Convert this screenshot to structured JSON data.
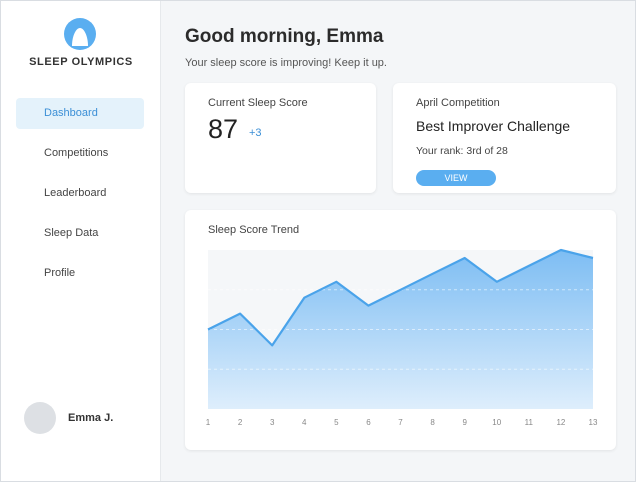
{
  "brand": {
    "name": "SLEEP OLYMPICS"
  },
  "sidebar": {
    "items": [
      {
        "label": "Dashboard",
        "active": true
      },
      {
        "label": "Competitions",
        "active": false
      },
      {
        "label": "Leaderboard",
        "active": false
      },
      {
        "label": "Sleep Data",
        "active": false
      },
      {
        "label": "Profile",
        "active": false
      }
    ],
    "user": {
      "name": "Emma J."
    }
  },
  "header": {
    "greeting": "Good morning, Emma",
    "subtitle": "Your sleep score is improving! Keep it up."
  },
  "score_card": {
    "label": "Current Sleep Score",
    "value": "87",
    "delta": "+3"
  },
  "competition_card": {
    "label": "April Competition",
    "title": "Best Improver Challenge",
    "rank": "Your rank: 3rd of 28",
    "button_label": "VIEW"
  },
  "colors": {
    "accent": "#3b8fd6",
    "line": "#4aa3ea",
    "button": "#5aaef0",
    "nav_active_bg": "#e4f2fb"
  },
  "chart_data": {
    "type": "area",
    "title": "Sleep Score Trend",
    "x": [
      1,
      2,
      3,
      4,
      5,
      6,
      7,
      8,
      9,
      10,
      11,
      12,
      13
    ],
    "values": [
      70,
      74,
      66,
      78,
      82,
      76,
      80,
      84,
      88,
      82,
      86,
      90,
      88
    ],
    "ylim": [
      50,
      90
    ],
    "grid": true
  }
}
